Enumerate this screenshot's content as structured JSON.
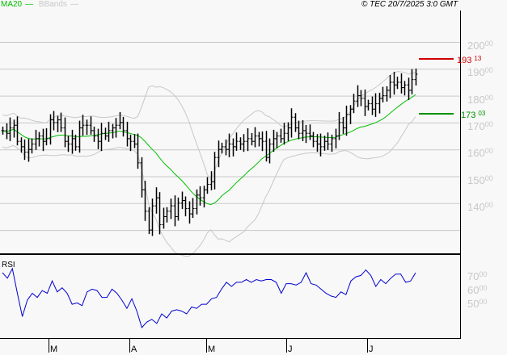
{
  "legend": {
    "ma_label": "MA20",
    "bb_label": "BBands"
  },
  "copyright": "© TEC 20/7/2025 3:0 GMT",
  "colors": {
    "ma": "#00c000",
    "bands": "#c8c8c8",
    "rsi": "#0000d0",
    "resistance": "#d00000",
    "support": "#009000"
  },
  "chart_data": {
    "type": "ohlc",
    "price_axis": {
      "ticks": [
        {
          "int": "200",
          "dec": "00",
          "value": 20000
        },
        {
          "int": "190",
          "dec": "00",
          "value": 19000
        },
        {
          "int": "180",
          "dec": "00",
          "value": 18000
        },
        {
          "int": "170",
          "dec": "00",
          "value": 17000
        },
        {
          "int": "160",
          "dec": "00",
          "value": 16000
        },
        {
          "int": "150",
          "dec": "00",
          "value": 15000
        },
        {
          "int": "140",
          "dec": "00",
          "value": 14000
        }
      ],
      "range": [
        12000,
        21000
      ]
    },
    "resistance": {
      "int": "193",
      "dec": "13",
      "value": 19313
    },
    "support": {
      "int": "173",
      "dec": "03",
      "value": 17303
    },
    "closes": [
      16700,
      16600,
      16800,
      16900,
      16300,
      16100,
      15900,
      16000,
      16200,
      16400,
      16500,
      16300,
      16400,
      17100,
      17000,
      17100,
      16800,
      16300,
      16200,
      16400,
      16100,
      16800,
      16900,
      16900,
      16700,
      16500,
      16300,
      16600,
      16500,
      16700,
      16800,
      16900,
      17000,
      16700,
      16400,
      16300,
      16200,
      15500,
      14500,
      13700,
      13000,
      13900,
      14200,
      13200,
      13500,
      13700,
      13900,
      13500,
      14000,
      14100,
      13800,
      13600,
      13800,
      14300,
      14200,
      14500,
      14700,
      14800,
      15700,
      16000,
      16100,
      16000,
      16200,
      16100,
      16300,
      16200,
      16300,
      16400,
      16300,
      16500,
      16400,
      16300,
      15700,
      16200,
      16400,
      16500,
      16400,
      16600,
      16800,
      17200,
      16800,
      16600,
      16700,
      16600,
      16500,
      16300,
      16200,
      16100,
      16300,
      16200,
      16400,
      16500,
      17000,
      16800,
      17300,
      17500,
      17800,
      18000,
      17900,
      17600,
      17700,
      17500,
      17700,
      17900,
      18000,
      18200,
      18500,
      18400,
      18500,
      18300,
      18400,
      18200,
      18600,
      18800
    ],
    "rsi": {
      "label": "RSI",
      "ticks": [
        {
          "int": "70",
          "dec": "00",
          "value": 70
        },
        {
          "int": "60",
          "dec": "00",
          "value": 60
        },
        {
          "int": "50",
          "dec": "00",
          "value": 50
        }
      ],
      "range": [
        20,
        83
      ],
      "values": [
        70,
        66,
        73,
        55,
        38,
        50,
        55,
        52,
        57,
        55,
        64,
        56,
        59,
        55,
        47,
        48,
        46,
        56,
        58,
        57,
        52,
        52,
        58,
        55,
        50,
        44,
        51,
        42,
        30,
        34,
        36,
        33,
        40,
        37,
        42,
        43,
        42,
        40,
        45,
        44,
        47,
        47,
        51,
        52,
        58,
        63,
        60,
        63,
        63,
        65,
        63,
        65,
        64,
        65,
        65,
        63,
        55,
        62,
        62,
        61,
        63,
        70,
        62,
        61,
        58,
        55,
        53,
        52,
        56,
        54,
        64,
        67,
        68,
        72,
        68,
        60,
        65,
        62,
        66,
        69,
        69,
        63,
        64,
        70
      ]
    },
    "months": [
      "M",
      "A",
      "M",
      "J",
      "J"
    ],
    "indicators": [
      "MA20",
      "BBands"
    ]
  }
}
